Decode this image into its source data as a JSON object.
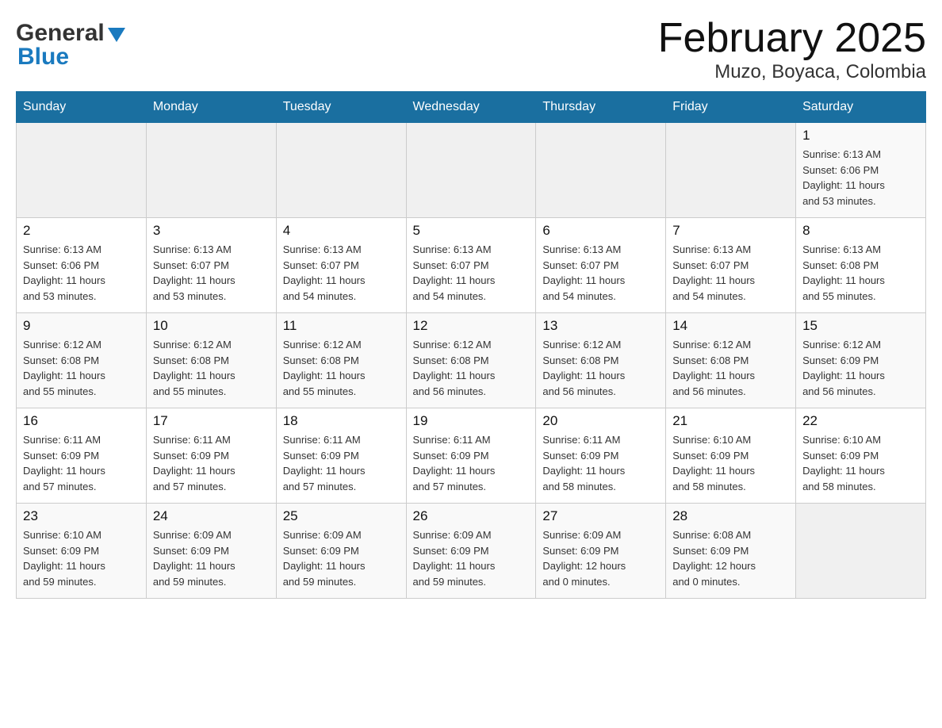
{
  "header": {
    "logo_line1": "General",
    "logo_line2": "Blue",
    "title": "February 2025",
    "subtitle": "Muzo, Boyaca, Colombia"
  },
  "days_of_week": [
    "Sunday",
    "Monday",
    "Tuesday",
    "Wednesday",
    "Thursday",
    "Friday",
    "Saturday"
  ],
  "weeks": [
    [
      {
        "day": "",
        "info": ""
      },
      {
        "day": "",
        "info": ""
      },
      {
        "day": "",
        "info": ""
      },
      {
        "day": "",
        "info": ""
      },
      {
        "day": "",
        "info": ""
      },
      {
        "day": "",
        "info": ""
      },
      {
        "day": "1",
        "info": "Sunrise: 6:13 AM\nSunset: 6:06 PM\nDaylight: 11 hours\nand 53 minutes."
      }
    ],
    [
      {
        "day": "2",
        "info": "Sunrise: 6:13 AM\nSunset: 6:06 PM\nDaylight: 11 hours\nand 53 minutes."
      },
      {
        "day": "3",
        "info": "Sunrise: 6:13 AM\nSunset: 6:07 PM\nDaylight: 11 hours\nand 53 minutes."
      },
      {
        "day": "4",
        "info": "Sunrise: 6:13 AM\nSunset: 6:07 PM\nDaylight: 11 hours\nand 54 minutes."
      },
      {
        "day": "5",
        "info": "Sunrise: 6:13 AM\nSunset: 6:07 PM\nDaylight: 11 hours\nand 54 minutes."
      },
      {
        "day": "6",
        "info": "Sunrise: 6:13 AM\nSunset: 6:07 PM\nDaylight: 11 hours\nand 54 minutes."
      },
      {
        "day": "7",
        "info": "Sunrise: 6:13 AM\nSunset: 6:07 PM\nDaylight: 11 hours\nand 54 minutes."
      },
      {
        "day": "8",
        "info": "Sunrise: 6:13 AM\nSunset: 6:08 PM\nDaylight: 11 hours\nand 55 minutes."
      }
    ],
    [
      {
        "day": "9",
        "info": "Sunrise: 6:12 AM\nSunset: 6:08 PM\nDaylight: 11 hours\nand 55 minutes."
      },
      {
        "day": "10",
        "info": "Sunrise: 6:12 AM\nSunset: 6:08 PM\nDaylight: 11 hours\nand 55 minutes."
      },
      {
        "day": "11",
        "info": "Sunrise: 6:12 AM\nSunset: 6:08 PM\nDaylight: 11 hours\nand 55 minutes."
      },
      {
        "day": "12",
        "info": "Sunrise: 6:12 AM\nSunset: 6:08 PM\nDaylight: 11 hours\nand 56 minutes."
      },
      {
        "day": "13",
        "info": "Sunrise: 6:12 AM\nSunset: 6:08 PM\nDaylight: 11 hours\nand 56 minutes."
      },
      {
        "day": "14",
        "info": "Sunrise: 6:12 AM\nSunset: 6:08 PM\nDaylight: 11 hours\nand 56 minutes."
      },
      {
        "day": "15",
        "info": "Sunrise: 6:12 AM\nSunset: 6:09 PM\nDaylight: 11 hours\nand 56 minutes."
      }
    ],
    [
      {
        "day": "16",
        "info": "Sunrise: 6:11 AM\nSunset: 6:09 PM\nDaylight: 11 hours\nand 57 minutes."
      },
      {
        "day": "17",
        "info": "Sunrise: 6:11 AM\nSunset: 6:09 PM\nDaylight: 11 hours\nand 57 minutes."
      },
      {
        "day": "18",
        "info": "Sunrise: 6:11 AM\nSunset: 6:09 PM\nDaylight: 11 hours\nand 57 minutes."
      },
      {
        "day": "19",
        "info": "Sunrise: 6:11 AM\nSunset: 6:09 PM\nDaylight: 11 hours\nand 57 minutes."
      },
      {
        "day": "20",
        "info": "Sunrise: 6:11 AM\nSunset: 6:09 PM\nDaylight: 11 hours\nand 58 minutes."
      },
      {
        "day": "21",
        "info": "Sunrise: 6:10 AM\nSunset: 6:09 PM\nDaylight: 11 hours\nand 58 minutes."
      },
      {
        "day": "22",
        "info": "Sunrise: 6:10 AM\nSunset: 6:09 PM\nDaylight: 11 hours\nand 58 minutes."
      }
    ],
    [
      {
        "day": "23",
        "info": "Sunrise: 6:10 AM\nSunset: 6:09 PM\nDaylight: 11 hours\nand 59 minutes."
      },
      {
        "day": "24",
        "info": "Sunrise: 6:09 AM\nSunset: 6:09 PM\nDaylight: 11 hours\nand 59 minutes."
      },
      {
        "day": "25",
        "info": "Sunrise: 6:09 AM\nSunset: 6:09 PM\nDaylight: 11 hours\nand 59 minutes."
      },
      {
        "day": "26",
        "info": "Sunrise: 6:09 AM\nSunset: 6:09 PM\nDaylight: 11 hours\nand 59 minutes."
      },
      {
        "day": "27",
        "info": "Sunrise: 6:09 AM\nSunset: 6:09 PM\nDaylight: 12 hours\nand 0 minutes."
      },
      {
        "day": "28",
        "info": "Sunrise: 6:08 AM\nSunset: 6:09 PM\nDaylight: 12 hours\nand 0 minutes."
      },
      {
        "day": "",
        "info": ""
      }
    ]
  ]
}
